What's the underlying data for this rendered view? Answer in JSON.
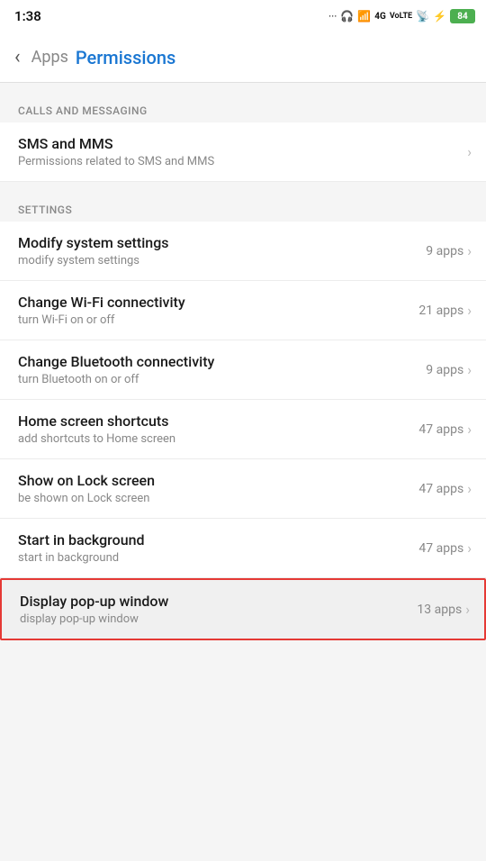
{
  "statusBar": {
    "time": "1:38",
    "batteryLevel": "84",
    "batteryColor": "#4caf50"
  },
  "nav": {
    "backLabel": "‹",
    "appsLabel": "Apps",
    "permissionsLabel": "Permissions"
  },
  "sections": [
    {
      "id": "calls-messaging",
      "header": "CALLS AND MESSAGING",
      "items": [
        {
          "id": "sms-mms",
          "title": "SMS and MMS",
          "subtitle": "Permissions related to SMS and MMS",
          "count": null,
          "highlighted": false
        }
      ]
    },
    {
      "id": "settings",
      "header": "SETTINGS",
      "items": [
        {
          "id": "modify-system-settings",
          "title": "Modify system settings",
          "subtitle": "modify system settings",
          "count": "9 apps",
          "highlighted": false
        },
        {
          "id": "change-wifi",
          "title": "Change Wi-Fi connectivity",
          "subtitle": "turn Wi-Fi on or off",
          "count": "21 apps",
          "highlighted": false
        },
        {
          "id": "change-bluetooth",
          "title": "Change Bluetooth connectivity",
          "subtitle": "turn Bluetooth on or off",
          "count": "9 apps",
          "highlighted": false
        },
        {
          "id": "home-screen-shortcuts",
          "title": "Home screen shortcuts",
          "subtitle": "add shortcuts to Home screen",
          "count": "47 apps",
          "highlighted": false
        },
        {
          "id": "show-lock-screen",
          "title": "Show on Lock screen",
          "subtitle": "be shown on Lock screen",
          "count": "47 apps",
          "highlighted": false
        },
        {
          "id": "start-background",
          "title": "Start in background",
          "subtitle": "start in background",
          "count": "47 apps",
          "highlighted": false
        },
        {
          "id": "display-popup",
          "title": "Display pop-up window",
          "subtitle": "display pop-up window",
          "count": "13 apps",
          "highlighted": true
        }
      ]
    }
  ]
}
